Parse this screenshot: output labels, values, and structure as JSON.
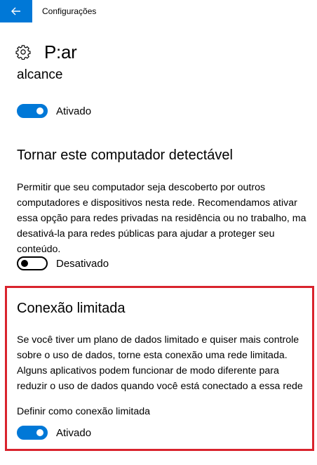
{
  "window": {
    "title": "Configurações"
  },
  "page": {
    "title": "P:ar",
    "wrapped_fragment": "alcance"
  },
  "top_toggle": {
    "state": "on",
    "label": "Ativado"
  },
  "discoverable": {
    "heading": "Tornar este computador detectável",
    "description_lines": [
      "Permitir que seu computador seja descoberto por outros",
      "computadores e dispositivos nesta rede. Recomendamos ativar",
      "essa opção para redes privadas na residência ou no trabalho, ma",
      "desativá-la para redes públicas para ajudar a proteger seu",
      "conteúdo."
    ],
    "toggle": {
      "state": "off",
      "label": "Desativado"
    }
  },
  "metered": {
    "heading": "Conexão limitada",
    "description_lines": [
      "Se você tiver um plano de dados limitado e quiser mais controle",
      "sobre o uso de dados, torne esta conexão uma rede limitada.",
      "Alguns aplicativos podem funcionar de modo diferente para",
      "reduzir o uso de dados quando você está conectado a essa rede"
    ],
    "setting_label": "Definir como conexão limitada",
    "toggle": {
      "state": "on",
      "label": "Ativado"
    }
  },
  "colors": {
    "accent": "#0078d7",
    "highlight": "#d9232d"
  },
  "icons": {
    "back": "back-arrow-icon",
    "settings": "gear-icon"
  }
}
